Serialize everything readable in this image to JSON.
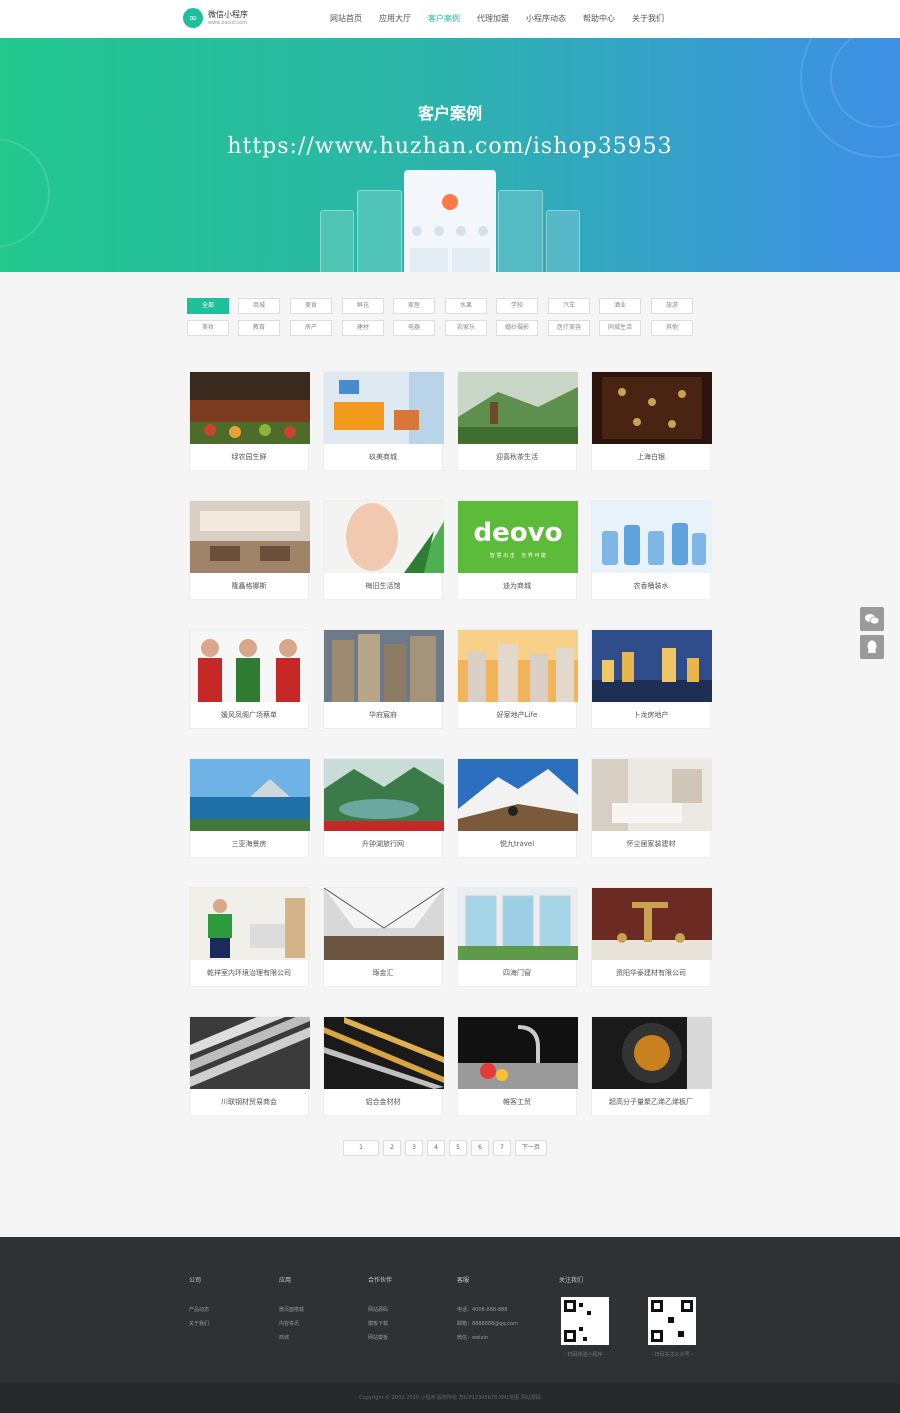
{
  "header": {
    "logo_title": "微信小程序",
    "logo_sub": "www.baisd.com",
    "nav": [
      "网站首页",
      "应用大厅",
      "客户案例",
      "代理加盟",
      "小程序动态",
      "帮助中心",
      "关于我们"
    ]
  },
  "banner": {
    "title": "客户案例",
    "url": "https://www.huzhan.com/ishop35953"
  },
  "filters": {
    "row1": [
      "全部",
      "商城",
      "美食",
      "鲜花",
      "家居",
      "水果",
      "学校",
      "汽车",
      "酒业",
      "旅游"
    ],
    "row2": [
      "美妆",
      "教育",
      "房产",
      "建材",
      "电器",
      "农家乐",
      "婚纱摄影",
      "医疗美容",
      "同城生活",
      "其他"
    ],
    "active": "全部"
  },
  "cards": [
    "绿农园生鲜",
    "玖美商城",
    "迎喜秋茶生活",
    "上海白银",
    "隆鑫格娜斯",
    "梅旧生活馆",
    "迪为商城",
    "农香桶装水",
    "媛风凤阁广场蔡单",
    "华府宸府",
    "好家地产Life",
    "卜龙房地产",
    "三亚海景房",
    "升钟湖旅行网",
    "悦九travel",
    "怀尘居家装建材",
    "乾祥室内环境治理有限公司",
    "琢金汇",
    "四海门窗",
    "资阳华泰建材有限公司",
    "川联钢材贸易商会",
    "铝合金材材",
    "帷客工贸",
    "超高分子量聚乙烯乙烯板厂"
  ],
  "pagination": [
    "1",
    "2",
    "3",
    "4",
    "5",
    "6",
    "7",
    "下一页"
  ],
  "footer": {
    "col1": {
      "head": "公司",
      "links": [
        "产品动态",
        "关于我们"
      ]
    },
    "col2": {
      "head": "应用",
      "links": [
        "微页面搭载",
        "内容资讯",
        "商城"
      ]
    },
    "col3": {
      "head": "合作伙伴",
      "links": [
        "网站源码",
        "模板下载",
        "网站模板"
      ]
    },
    "col4": {
      "head": "客服",
      "links": [
        "电话：4008-888-888",
        "邮箱：8888888@qq.com",
        "微信：weixin"
      ]
    },
    "col5": {
      "head": "关注我们",
      "qr1": "- 扫码体验小程序 -",
      "qr2": "- 扫码关注公众号 -"
    },
    "copyright": "Copyright © 2002-2020 小程序 版权所有 苏ICP12345678 XML地图 网站源码"
  },
  "colors": {
    "accent": "#1fbf9b",
    "banner_left": "#22c88e",
    "banner_right": "#3e8fe6",
    "footer": "#2f3135"
  }
}
